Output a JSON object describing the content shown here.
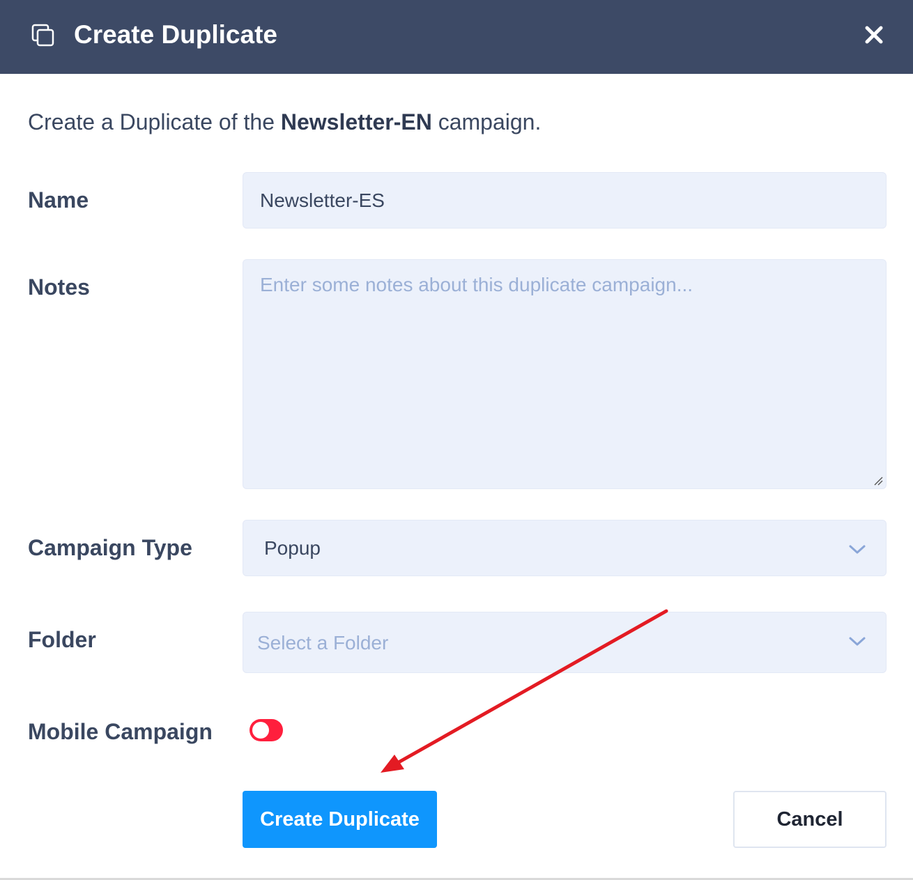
{
  "header": {
    "title": "Create Duplicate",
    "icon": "duplicate-icon",
    "close_icon": "close-icon"
  },
  "intro": {
    "prefix": "Create a Duplicate of the ",
    "campaign_name": "Newsletter-EN",
    "suffix": " campaign."
  },
  "form": {
    "name": {
      "label": "Name",
      "value": "Newsletter-ES"
    },
    "notes": {
      "label": "Notes",
      "value": "",
      "placeholder": "Enter some notes about this duplicate campaign..."
    },
    "campaign_type": {
      "label": "Campaign Type",
      "value": "Popup"
    },
    "folder": {
      "label": "Folder",
      "placeholder": "Select a Folder"
    },
    "mobile_campaign": {
      "label": "Mobile Campaign",
      "enabled": false
    }
  },
  "actions": {
    "create_label": "Create Duplicate",
    "cancel_label": "Cancel"
  },
  "colors": {
    "header_bg": "#3d4a66",
    "primary": "#0f96fd",
    "field_bg": "#ecf1fb",
    "toggle_off": "#ff1f3d",
    "annotation_arrow": "#e31b23"
  }
}
